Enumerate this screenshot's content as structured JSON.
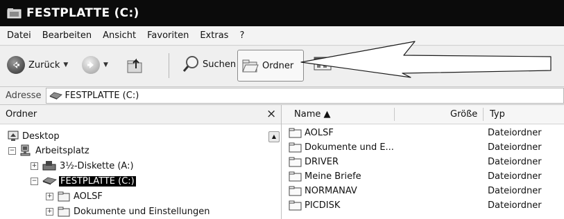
{
  "window": {
    "title": "FESTPLATTE (C:)"
  },
  "menu": [
    "Datei",
    "Bearbeiten",
    "Ansicht",
    "Favoriten",
    "Extras",
    "?"
  ],
  "toolbar": {
    "back_label": "Zurück",
    "search_label": "Suchen",
    "folders_label": "Ordner"
  },
  "address": {
    "label": "Adresse",
    "value": "FESTPLATTE (C:)"
  },
  "folders_pane": {
    "title": "Ordner",
    "close": "×",
    "items": [
      {
        "label": "Desktop"
      },
      {
        "label": "Arbeitsplatz"
      },
      {
        "label": "3½-Diskette (A:)"
      },
      {
        "label": "FESTPLATTE (C:)"
      },
      {
        "label": "AOLSF"
      },
      {
        "label": "Dokumente und Einstellungen"
      }
    ]
  },
  "file_list": {
    "columns": {
      "name": "Name ▲",
      "size": "Größe",
      "type": "Typ"
    },
    "rows": [
      {
        "name": "AOLSF",
        "type": "Dateiordner"
      },
      {
        "name": "Dokumente und E...",
        "type": "Dateiordner"
      },
      {
        "name": "DRIVER",
        "type": "Dateiordner"
      },
      {
        "name": "Meine Briefe",
        "type": "Dateiordner"
      },
      {
        "name": "NORMANAV",
        "type": "Dateiordner"
      },
      {
        "name": "PICDISK",
        "type": "Dateiordner"
      }
    ]
  },
  "colors": {
    "titlebar": "#0b0b0b",
    "selection": "#000000"
  }
}
